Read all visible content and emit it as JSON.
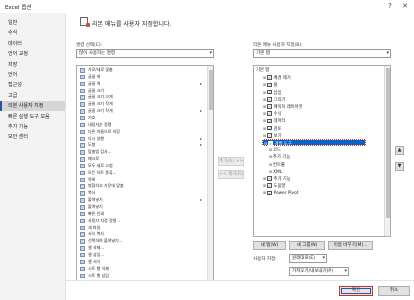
{
  "window": {
    "title": "Excel 옵션",
    "help_label": "?",
    "close_label": "✕"
  },
  "nav": {
    "items": [
      "일반",
      "수식",
      "데이터",
      "언어 교정",
      "저장",
      "언어",
      "접근성",
      "고급",
      "리본 사용자 지정",
      "빠른 실행 도구 모음",
      "추가 기능",
      "보안 센터"
    ],
    "selected": "리본 사용자 지정"
  },
  "heading": "리본 메뉴를 사용자 지정합니다.",
  "left": {
    "label": "명령 선택(C):",
    "dropdown_value": "많이 사용하는 명령",
    "commands": [
      {
        "label": "가로/세로 맞춤",
        "sub": ""
      },
      {
        "label": "글꼴 색",
        "sub": ""
      },
      {
        "label": "글꼴 색",
        "sub": "▸"
      },
      {
        "label": "글꼴 크기",
        "sub": ""
      },
      {
        "label": "글꼴 크기 크게",
        "sub": ""
      },
      {
        "label": "글꼴 크기 작게",
        "sub": ""
      },
      {
        "label": "글꼴 크기 작게",
        "sub": "▸"
      },
      {
        "label": "기호",
        "sub": ""
      },
      {
        "label": "내림차순 정렬",
        "sub": ""
      },
      {
        "label": "다른 이름으로 저장",
        "sub": ""
      },
      {
        "label": "다시 실행",
        "sub": "▸"
      },
      {
        "label": "도형",
        "sub": "▸"
      },
      {
        "label": "맞춤법 검사...",
        "sub": ""
      },
      {
        "label": "매크로",
        "sub": ""
      },
      {
        "label": "모두 새로 고침",
        "sub": ""
      },
      {
        "label": "모든 차트 종류...",
        "sub": ""
      },
      {
        "label": "목록",
        "sub": ""
      },
      {
        "label": "병합하고 가운데 맞춤",
        "sub": ""
      },
      {
        "label": "복사",
        "sub": ""
      },
      {
        "label": "붙여넣기",
        "sub": "▸"
      },
      {
        "label": "붙여넣기",
        "sub": ""
      },
      {
        "label": "빠른 인쇄",
        "sub": ""
      },
      {
        "label": "사용자 지정 정렬...",
        "sub": ""
      },
      {
        "label": "새 파일",
        "sub": ""
      },
      {
        "label": "서식 복사",
        "sub": ""
      },
      {
        "label": "선택하여 붙여넣기...",
        "sub": ""
      },
      {
        "label": "셀 삭제...",
        "sub": ""
      },
      {
        "label": "셀 삽입...",
        "sub": ""
      },
      {
        "label": "셀 서식",
        "sub": ""
      },
      {
        "label": "시트 행 삭제",
        "sub": ""
      },
      {
        "label": "시트 행 삽입",
        "sub": ""
      }
    ]
  },
  "middle": {
    "add_label": "추가(A) >>",
    "remove_label": "<< 제거(R)"
  },
  "right": {
    "label": "리본 메뉴 사용자 지정(B):",
    "dropdown_value": "기본 탭",
    "tree": [
      {
        "label": "기본 탭",
        "level": 0,
        "exp": "",
        "cb": false,
        "checked": false
      },
      {
        "label": "배경 제거",
        "level": 1,
        "exp": "⊞",
        "cb": true,
        "checked": true
      },
      {
        "label": "홈",
        "level": 1,
        "exp": "⊞",
        "cb": true,
        "checked": true
      },
      {
        "label": "삽입",
        "level": 1,
        "exp": "⊞",
        "cb": true,
        "checked": true
      },
      {
        "label": "그리기",
        "level": 1,
        "exp": "⊞",
        "cb": true,
        "checked": true
      },
      {
        "label": "페이지 레이아웃",
        "level": 1,
        "exp": "⊞",
        "cb": true,
        "checked": true
      },
      {
        "label": "수식",
        "level": 1,
        "exp": "⊞",
        "cb": true,
        "checked": true
      },
      {
        "label": "데이터",
        "level": 1,
        "exp": "⊞",
        "cb": true,
        "checked": true
      },
      {
        "label": "검토",
        "level": 1,
        "exp": "⊞",
        "cb": true,
        "checked": true
      },
      {
        "label": "보기",
        "level": 1,
        "exp": "⊞",
        "cb": true,
        "checked": true
      },
      {
        "label": "개발 도구",
        "level": 1,
        "exp": "⊟",
        "cb": true,
        "checked": true
      },
      {
        "label": "코드",
        "level": 2,
        "exp": "⊞",
        "cb": false,
        "checked": false
      },
      {
        "label": "추가 기능",
        "level": 2,
        "exp": "⊞",
        "cb": false,
        "checked": false
      },
      {
        "label": "컨트롤",
        "level": 2,
        "exp": "⊞",
        "cb": false,
        "checked": false
      },
      {
        "label": "XML",
        "level": 2,
        "exp": "⊞",
        "cb": false,
        "checked": false
      },
      {
        "label": "추가 기능",
        "level": 1,
        "exp": "⊞",
        "cb": true,
        "checked": true
      },
      {
        "label": "도움말",
        "level": 1,
        "exp": "⊞",
        "cb": true,
        "checked": true
      },
      {
        "label": "Power Pivot",
        "level": 1,
        "exp": "⊞",
        "cb": true,
        "checked": true
      }
    ],
    "selected_index": 10,
    "move_up": "▲",
    "move_down": "▼",
    "new_tab": "새 탭(W)",
    "new_group": "새 그룹(N)",
    "rename": "이름 바꾸기(M)...",
    "customize_label": "사용자 지정:",
    "reset_value": "원래대로(E)",
    "import_export": "가져오기/내보내기(P)"
  },
  "footer": {
    "ok": "확인",
    "cancel": "취소"
  }
}
